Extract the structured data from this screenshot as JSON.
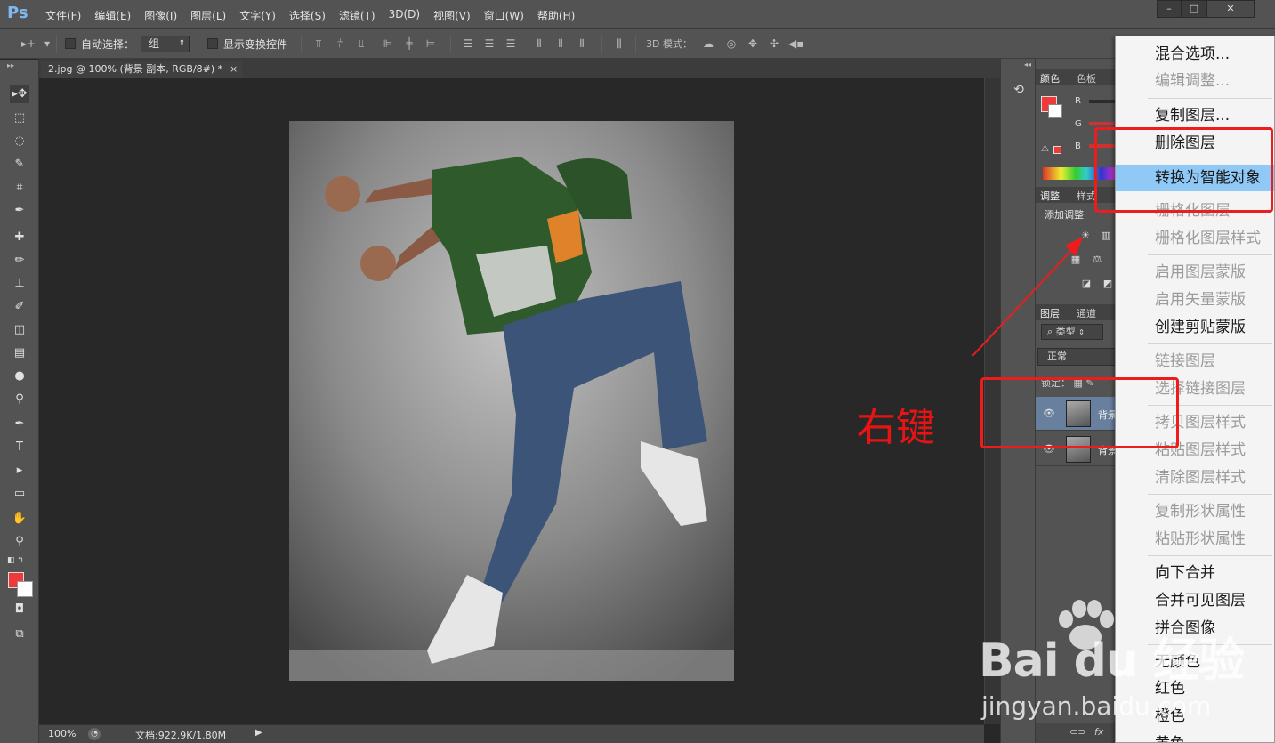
{
  "app": {
    "logo": "Ps",
    "menu": [
      "文件(F)",
      "编辑(E)",
      "图像(I)",
      "图层(L)",
      "文字(Y)",
      "选择(S)",
      "滤镜(T)",
      "3D(D)",
      "视图(V)",
      "窗口(W)",
      "帮助(H)"
    ],
    "window_controls": [
      "minimize-icon",
      "maximize-icon",
      "close-icon"
    ]
  },
  "options_bar": {
    "auto_select_label": "自动选择：",
    "auto_select_value": "组",
    "show_transform_label": "显示变换控件",
    "mode_3d_label": "3D 模式："
  },
  "document": {
    "tab_title": "2.jpg @ 100% (背景 副本, RGB/8#) *",
    "tab_close": "×"
  },
  "status_bar": {
    "zoom": "100%",
    "doc_size": "文档:922.9K/1.80M"
  },
  "panels": {
    "color_tabs": [
      "颜色",
      "色板"
    ],
    "channels": [
      "R",
      "G",
      "B"
    ],
    "adjust_tabs": [
      "调整",
      "样式"
    ],
    "adjust_title": "添加调整",
    "layer_tabs": [
      "图层",
      "通道"
    ],
    "layer_filter": "类型",
    "blend_mode": "正常",
    "lock_label": "锁定：",
    "layers": [
      {
        "name": "背景 副本",
        "selected": true
      },
      {
        "name": "背景",
        "selected": false
      }
    ],
    "footer_icons": [
      "link-icon",
      "fx-icon"
    ]
  },
  "context_menu": {
    "items": [
      {
        "label": "混合选项...",
        "disabled": false
      },
      {
        "label": "编辑调整...",
        "disabled": true
      },
      {
        "label": "复制图层...",
        "disabled": false
      },
      {
        "label": "删除图层",
        "disabled": false
      },
      {
        "label": "转换为智能对象",
        "disabled": false,
        "highlighted": true
      },
      {
        "label": "栅格化图层",
        "disabled": true
      },
      {
        "label": "栅格化图层样式",
        "disabled": true
      },
      {
        "label": "启用图层蒙版",
        "disabled": true
      },
      {
        "label": "启用矢量蒙版",
        "disabled": true
      },
      {
        "label": "创建剪贴蒙版",
        "disabled": false
      },
      {
        "label": "链接图层",
        "disabled": true
      },
      {
        "label": "选择链接图层",
        "disabled": true
      },
      {
        "label": "拷贝图层样式",
        "disabled": true
      },
      {
        "label": "粘贴图层样式",
        "disabled": true
      },
      {
        "label": "清除图层样式",
        "disabled": true
      },
      {
        "label": "复制形状属性",
        "disabled": true
      },
      {
        "label": "粘贴形状属性",
        "disabled": true
      },
      {
        "label": "向下合并",
        "disabled": false
      },
      {
        "label": "合并可见图层",
        "disabled": false
      },
      {
        "label": "拼合图像",
        "disabled": false
      },
      {
        "label": "无颜色",
        "disabled": false
      },
      {
        "label": "红色",
        "disabled": false
      },
      {
        "label": "橙色",
        "disabled": false
      },
      {
        "label": "黄色",
        "disabled": false
      }
    ]
  },
  "annotations": {
    "right_click_label": "右键",
    "accent_color": "#ee1c1c"
  },
  "watermark": {
    "brand": "Bai du 经验",
    "url": "jingyan.baidu.com"
  },
  "colors": {
    "foreground": "#f03a3a",
    "background": "#ffffff",
    "menu_highlight": "#90c8f6"
  }
}
